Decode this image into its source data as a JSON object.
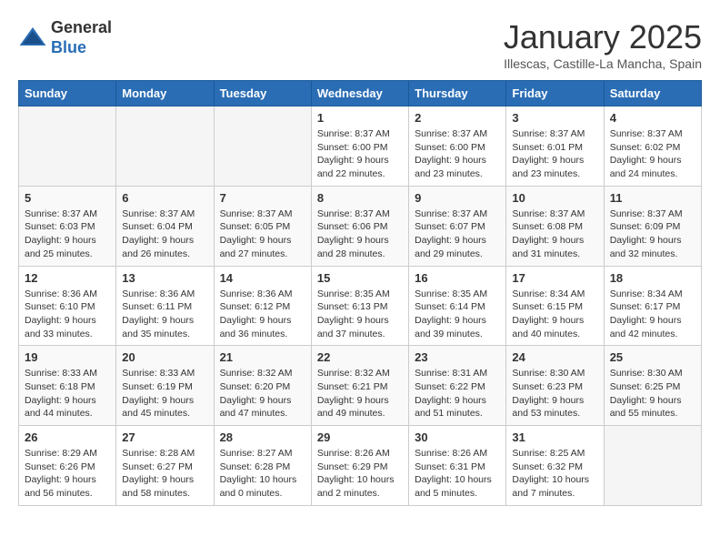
{
  "logo": {
    "general": "General",
    "blue": "Blue"
  },
  "header": {
    "month": "January 2025",
    "location": "Illescas, Castille-La Mancha, Spain"
  },
  "weekdays": [
    "Sunday",
    "Monday",
    "Tuesday",
    "Wednesday",
    "Thursday",
    "Friday",
    "Saturday"
  ],
  "weeks": [
    [
      {
        "day": "",
        "sunrise": "",
        "sunset": "",
        "daylight": ""
      },
      {
        "day": "",
        "sunrise": "",
        "sunset": "",
        "daylight": ""
      },
      {
        "day": "",
        "sunrise": "",
        "sunset": "",
        "daylight": ""
      },
      {
        "day": "1",
        "sunrise": "Sunrise: 8:37 AM",
        "sunset": "Sunset: 6:00 PM",
        "daylight": "Daylight: 9 hours and 22 minutes."
      },
      {
        "day": "2",
        "sunrise": "Sunrise: 8:37 AM",
        "sunset": "Sunset: 6:00 PM",
        "daylight": "Daylight: 9 hours and 23 minutes."
      },
      {
        "day": "3",
        "sunrise": "Sunrise: 8:37 AM",
        "sunset": "Sunset: 6:01 PM",
        "daylight": "Daylight: 9 hours and 23 minutes."
      },
      {
        "day": "4",
        "sunrise": "Sunrise: 8:37 AM",
        "sunset": "Sunset: 6:02 PM",
        "daylight": "Daylight: 9 hours and 24 minutes."
      }
    ],
    [
      {
        "day": "5",
        "sunrise": "Sunrise: 8:37 AM",
        "sunset": "Sunset: 6:03 PM",
        "daylight": "Daylight: 9 hours and 25 minutes."
      },
      {
        "day": "6",
        "sunrise": "Sunrise: 8:37 AM",
        "sunset": "Sunset: 6:04 PM",
        "daylight": "Daylight: 9 hours and 26 minutes."
      },
      {
        "day": "7",
        "sunrise": "Sunrise: 8:37 AM",
        "sunset": "Sunset: 6:05 PM",
        "daylight": "Daylight: 9 hours and 27 minutes."
      },
      {
        "day": "8",
        "sunrise": "Sunrise: 8:37 AM",
        "sunset": "Sunset: 6:06 PM",
        "daylight": "Daylight: 9 hours and 28 minutes."
      },
      {
        "day": "9",
        "sunrise": "Sunrise: 8:37 AM",
        "sunset": "Sunset: 6:07 PM",
        "daylight": "Daylight: 9 hours and 29 minutes."
      },
      {
        "day": "10",
        "sunrise": "Sunrise: 8:37 AM",
        "sunset": "Sunset: 6:08 PM",
        "daylight": "Daylight: 9 hours and 31 minutes."
      },
      {
        "day": "11",
        "sunrise": "Sunrise: 8:37 AM",
        "sunset": "Sunset: 6:09 PM",
        "daylight": "Daylight: 9 hours and 32 minutes."
      }
    ],
    [
      {
        "day": "12",
        "sunrise": "Sunrise: 8:36 AM",
        "sunset": "Sunset: 6:10 PM",
        "daylight": "Daylight: 9 hours and 33 minutes."
      },
      {
        "day": "13",
        "sunrise": "Sunrise: 8:36 AM",
        "sunset": "Sunset: 6:11 PM",
        "daylight": "Daylight: 9 hours and 35 minutes."
      },
      {
        "day": "14",
        "sunrise": "Sunrise: 8:36 AM",
        "sunset": "Sunset: 6:12 PM",
        "daylight": "Daylight: 9 hours and 36 minutes."
      },
      {
        "day": "15",
        "sunrise": "Sunrise: 8:35 AM",
        "sunset": "Sunset: 6:13 PM",
        "daylight": "Daylight: 9 hours and 37 minutes."
      },
      {
        "day": "16",
        "sunrise": "Sunrise: 8:35 AM",
        "sunset": "Sunset: 6:14 PM",
        "daylight": "Daylight: 9 hours and 39 minutes."
      },
      {
        "day": "17",
        "sunrise": "Sunrise: 8:34 AM",
        "sunset": "Sunset: 6:15 PM",
        "daylight": "Daylight: 9 hours and 40 minutes."
      },
      {
        "day": "18",
        "sunrise": "Sunrise: 8:34 AM",
        "sunset": "Sunset: 6:17 PM",
        "daylight": "Daylight: 9 hours and 42 minutes."
      }
    ],
    [
      {
        "day": "19",
        "sunrise": "Sunrise: 8:33 AM",
        "sunset": "Sunset: 6:18 PM",
        "daylight": "Daylight: 9 hours and 44 minutes."
      },
      {
        "day": "20",
        "sunrise": "Sunrise: 8:33 AM",
        "sunset": "Sunset: 6:19 PM",
        "daylight": "Daylight: 9 hours and 45 minutes."
      },
      {
        "day": "21",
        "sunrise": "Sunrise: 8:32 AM",
        "sunset": "Sunset: 6:20 PM",
        "daylight": "Daylight: 9 hours and 47 minutes."
      },
      {
        "day": "22",
        "sunrise": "Sunrise: 8:32 AM",
        "sunset": "Sunset: 6:21 PM",
        "daylight": "Daylight: 9 hours and 49 minutes."
      },
      {
        "day": "23",
        "sunrise": "Sunrise: 8:31 AM",
        "sunset": "Sunset: 6:22 PM",
        "daylight": "Daylight: 9 hours and 51 minutes."
      },
      {
        "day": "24",
        "sunrise": "Sunrise: 8:30 AM",
        "sunset": "Sunset: 6:23 PM",
        "daylight": "Daylight: 9 hours and 53 minutes."
      },
      {
        "day": "25",
        "sunrise": "Sunrise: 8:30 AM",
        "sunset": "Sunset: 6:25 PM",
        "daylight": "Daylight: 9 hours and 55 minutes."
      }
    ],
    [
      {
        "day": "26",
        "sunrise": "Sunrise: 8:29 AM",
        "sunset": "Sunset: 6:26 PM",
        "daylight": "Daylight: 9 hours and 56 minutes."
      },
      {
        "day": "27",
        "sunrise": "Sunrise: 8:28 AM",
        "sunset": "Sunset: 6:27 PM",
        "daylight": "Daylight: 9 hours and 58 minutes."
      },
      {
        "day": "28",
        "sunrise": "Sunrise: 8:27 AM",
        "sunset": "Sunset: 6:28 PM",
        "daylight": "Daylight: 10 hours and 0 minutes."
      },
      {
        "day": "29",
        "sunrise": "Sunrise: 8:26 AM",
        "sunset": "Sunset: 6:29 PM",
        "daylight": "Daylight: 10 hours and 2 minutes."
      },
      {
        "day": "30",
        "sunrise": "Sunrise: 8:26 AM",
        "sunset": "Sunset: 6:31 PM",
        "daylight": "Daylight: 10 hours and 5 minutes."
      },
      {
        "day": "31",
        "sunrise": "Sunrise: 8:25 AM",
        "sunset": "Sunset: 6:32 PM",
        "daylight": "Daylight: 10 hours and 7 minutes."
      },
      {
        "day": "",
        "sunrise": "",
        "sunset": "",
        "daylight": ""
      }
    ]
  ]
}
